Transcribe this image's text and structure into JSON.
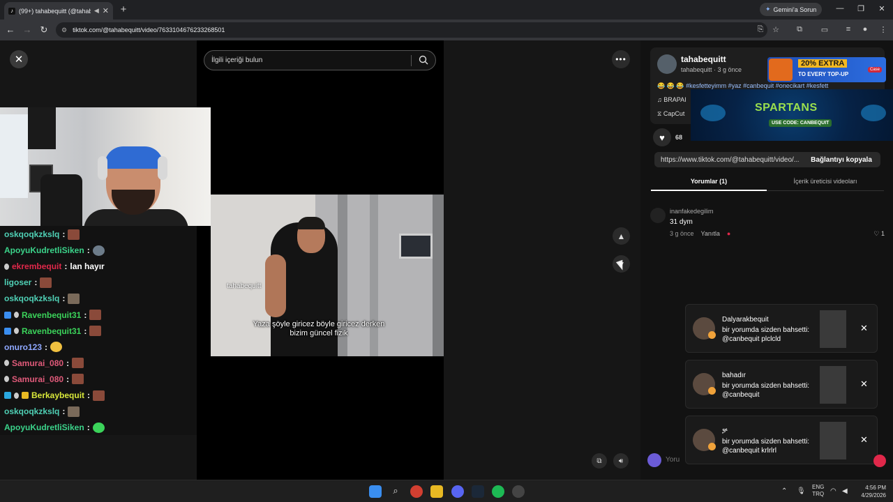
{
  "browser": {
    "tab_title": "(99+) tahabequitt (@tahabe",
    "new_tab_icon": "plus-icon",
    "gemini_button": "Gemini'a Sorun",
    "url": "tiktok.com/@tahabequitt/video/7633104676233268501"
  },
  "player": {
    "search_placeholder": "İlgili içeriği bulun",
    "close_label": "✕",
    "more_label": "•••",
    "up_label": "▲",
    "down_label": "▼"
  },
  "chat": [
    {
      "user": "oskqoqkzkslq",
      "color": "#4fd0b5",
      "emote": "e1",
      "badges": []
    },
    {
      "user": "ApoyuKudretliSiken",
      "color": "#3bd38a",
      "emote": "e2",
      "badges": []
    },
    {
      "user": "ekrembequit",
      "color": "#e0284a",
      "msg": "lan hayır",
      "badges": [
        "gray"
      ]
    },
    {
      "user": "ligoser",
      "color": "#4fd0b5",
      "emote": "e1",
      "badges": []
    },
    {
      "user": "oskqoqkzkslq",
      "color": "#4fd0b5",
      "emote": "e4",
      "badges": []
    },
    {
      "user": "Ravenbequit31",
      "color": "#3bd35a",
      "emote": "e1",
      "badges": [
        "blue",
        "gray"
      ]
    },
    {
      "user": "Ravenbequit31",
      "color": "#3bd35a",
      "emote": "e1",
      "badges": [
        "blue",
        "gray"
      ]
    },
    {
      "user": "onuro123",
      "color": "#8fa8ff",
      "emote": "e3",
      "badges": []
    },
    {
      "user": "Samurai_080",
      "color": "#e05a7a",
      "emote": "e1",
      "badges": [
        "gray"
      ]
    },
    {
      "user": "Samurai_080",
      "color": "#e05a7a",
      "emote": "e1",
      "badges": [
        "gray"
      ]
    },
    {
      "user": "Berkaybequit",
      "color": "#d9e83a",
      "emote": "e1",
      "badges": [
        "cyan",
        "gray",
        "gold"
      ]
    },
    {
      "user": "oskqoqkzkslq",
      "color": "#4fd0b5",
      "emote": "e4",
      "badges": []
    },
    {
      "user": "ApoyuKudretliSiken",
      "color": "#3bd38a",
      "emote": "e5",
      "badges": []
    }
  ],
  "video": {
    "watermark": "tahabequitt",
    "caption": "Yaza şöyle giricez böyle giricez derken bizim güncel fizik"
  },
  "creator": {
    "name": "tahabequitt",
    "sub": "tahabequitt · 3 g önce",
    "emojis": "😂 😂 😂",
    "hashtags": "#kesfetteyimm #yaz #canbequit #onecikart #kesfett",
    "music": "♫  BRAPAI",
    "capcut": "CapCut"
  },
  "ads": {
    "ad1_percent": "20% EXTRA",
    "ad1_sub": "TO EVERY TOP-UP",
    "ad1_brand": "Case",
    "ad2_name": "SPARTANS",
    "ad2_code": "USE CODE: CANBEQUIT"
  },
  "stats": {
    "likes": "68"
  },
  "link": {
    "url": "https://www.tiktok.com/@tahabequitt/video/...",
    "copy_label": "Bağlantıyı kopyala"
  },
  "tabs": {
    "comments": "Yorumlar (1)",
    "creator_videos": "İçerik üreticisi videoları"
  },
  "comment": {
    "user": "inanfakedegilim",
    "text": "31 dym",
    "time": "3 g önce",
    "reply": "Yanıtla",
    "likes": "♡ 1"
  },
  "notifications": [
    {
      "name": "Dalyarakbequit",
      "line1": "bir yorumda sizden bahsetti:",
      "line2": "@canbequit plclcld"
    },
    {
      "name": "bahadır",
      "line1": "bir yorumda sizden bahsetti:",
      "line2": "@canbequit"
    },
    {
      "name": "ቻ",
      "line1": "bir yorumda sizden bahsetti:",
      "line2": "@canbequit krlrlrl"
    }
  ],
  "comment_input": {
    "placeholder": "Yoru"
  },
  "taskbar": {
    "lang_line1": "ENG",
    "lang_line2": "TRQ",
    "time": "4:56 PM",
    "date": "4/29/2026",
    "chrome_badge": "99+"
  }
}
